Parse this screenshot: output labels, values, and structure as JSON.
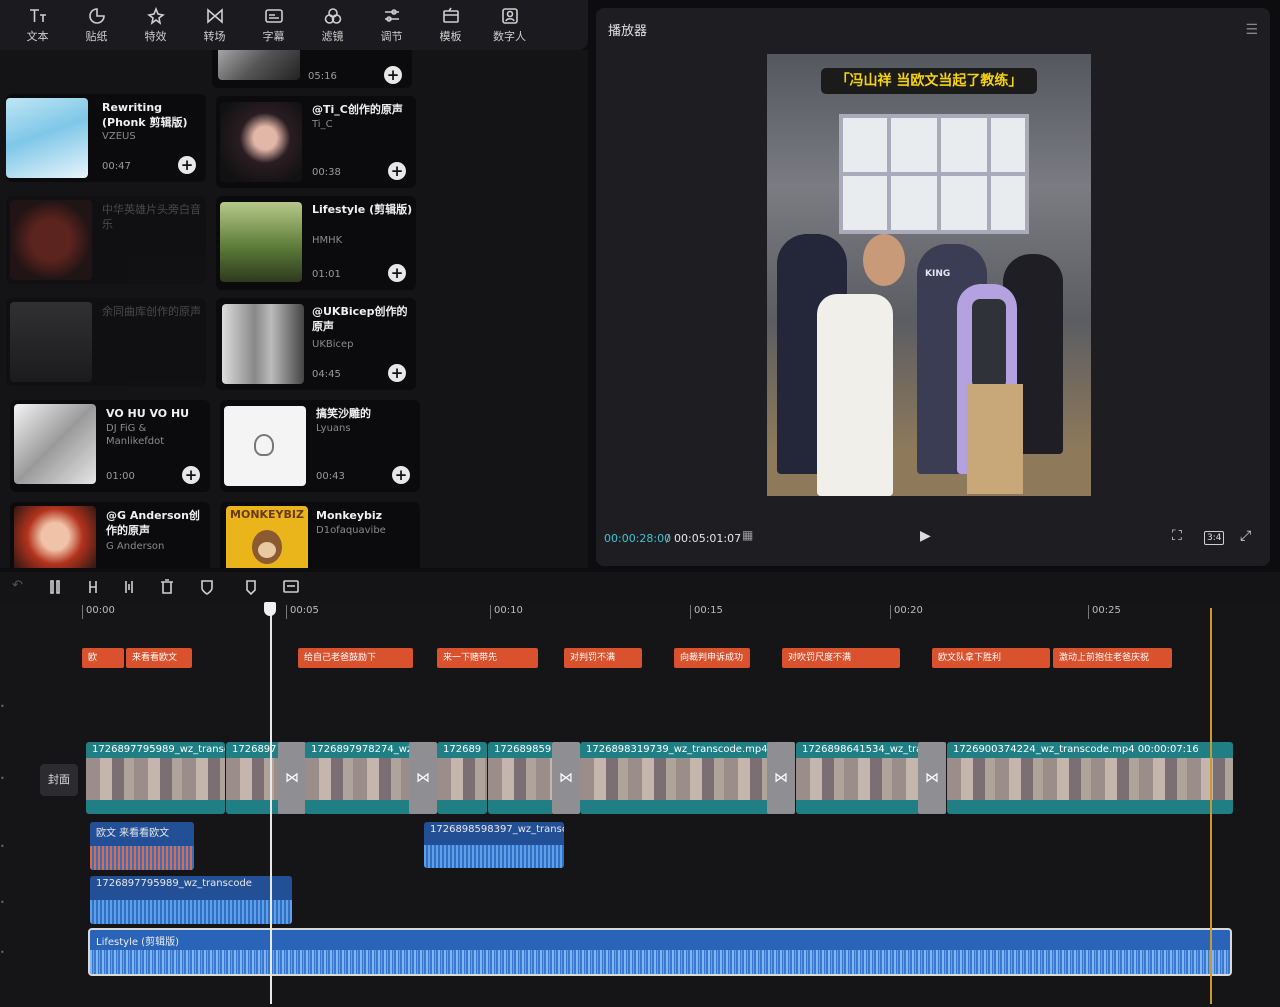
{
  "toolbar": {
    "items": [
      {
        "label": "文本",
        "icon": "text-icon"
      },
      {
        "label": "贴纸",
        "icon": "sticker-icon"
      },
      {
        "label": "特效",
        "icon": "effects-icon"
      },
      {
        "label": "转场",
        "icon": "transition-icon"
      },
      {
        "label": "字幕",
        "icon": "subtitle-icon"
      },
      {
        "label": "滤镜",
        "icon": "filter-icon"
      },
      {
        "label": "调节",
        "icon": "adjust-icon"
      },
      {
        "label": "模板",
        "icon": "template-icon"
      },
      {
        "label": "数字人",
        "icon": "digital-human-icon"
      }
    ]
  },
  "library": {
    "cards": [
      {
        "title": "",
        "artist": "",
        "duration": "05:16"
      },
      {
        "title": "Rewriting (Phonk 剪辑版)",
        "artist": "VZEUS",
        "duration": "00:47"
      },
      {
        "title": "@Ti_C创作的原声",
        "artist": "Ti_C",
        "duration": "00:38"
      },
      {
        "title": "中华英雄片头旁白音乐",
        "artist": "",
        "duration": ""
      },
      {
        "title": "Lifestyle (剪辑版)",
        "artist": "HMHK",
        "duration": "01:01"
      },
      {
        "title": "余同曲库创作的原声",
        "artist": "",
        "duration": ""
      },
      {
        "title": "@UKBicep创作的原声",
        "artist": "UKBicep",
        "duration": "04:45"
      },
      {
        "title": "VO HU VO HU",
        "artist": "DJ FiG & Manlikefdot",
        "duration": "01:00"
      },
      {
        "title": "搞笑沙雕的",
        "artist": "Lyuans",
        "duration": "00:43"
      },
      {
        "title": "@G Anderson创作的原声",
        "artist": "G Anderson",
        "duration": ""
      },
      {
        "title": "Monkeybiz",
        "artist": "D1ofaquavibe",
        "duration": ""
      }
    ],
    "monkeybiz_logo": "MONKEYBIZ"
  },
  "player": {
    "title": "播放器",
    "caption": "「冯山祥 当欧文当起了教练」",
    "current_time": "00:00:28:00",
    "separator": "/",
    "total_time": "00:05:01:07",
    "ratio": "3:4",
    "jersey_text": "KING"
  },
  "timeline": {
    "ruler": [
      "00:00",
      "00:05",
      "00:10",
      "00:15",
      "00:20",
      "00:25"
    ],
    "cover_label": "封面",
    "subtitles": [
      "欧",
      "来看看欧文",
      "给自己老爸鼓励下",
      "来一下赌带先",
      "对判罚不满",
      "向裁判申诉成功",
      "对吹罚尺度不满",
      "欧文队拿下胜利",
      "激动上前抱住老爸庆祝"
    ],
    "video_clips": [
      {
        "label": "1726897795989_wz_transc"
      },
      {
        "label": "1726897"
      },
      {
        "label": "1726897978274_wz"
      },
      {
        "label": "172689"
      },
      {
        "label": "172689859"
      },
      {
        "label": "1726898319739_wz_transcode.mp4"
      },
      {
        "label": "1726898641534_wz_tran"
      },
      {
        "label": "1726900374224_wz_transcode.mp4  00:00:07:16"
      }
    ],
    "audio_clips": [
      {
        "label": "欧文 来看看欧文"
      },
      {
        "label": "1726898598397_wz_transco"
      },
      {
        "label": "1726897795989_wz_transcode"
      }
    ],
    "music_label": "Lifestyle (剪辑版)"
  }
}
